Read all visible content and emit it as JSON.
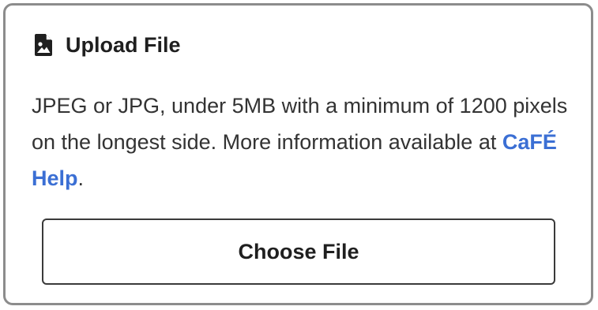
{
  "upload": {
    "icon": "file-image-icon",
    "title": "Upload File",
    "description_prefix": "JPEG or JPG, under 5MB with a minimum of 1200 pixels on the longest side. More information available at ",
    "help_link_label": "CaFÉ Help",
    "description_suffix": ".",
    "choose_button_label": "Choose File"
  },
  "colors": {
    "link": "#3b6fd4",
    "border": "#8c8c8c",
    "text": "#333333"
  }
}
